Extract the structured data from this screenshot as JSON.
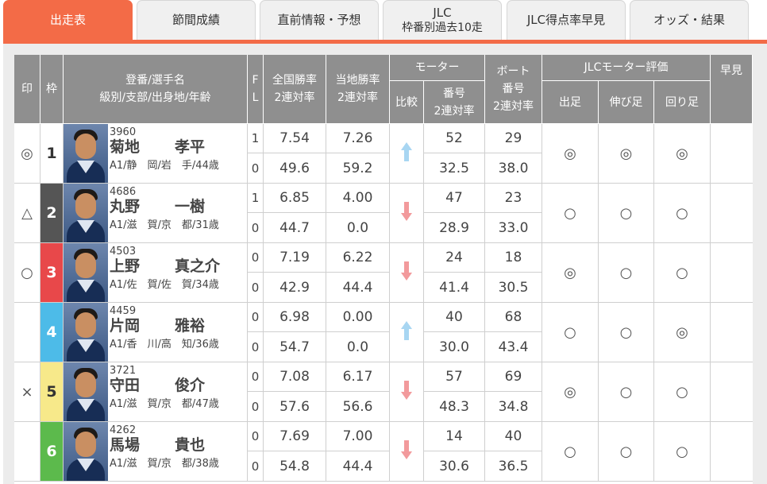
{
  "tabs": [
    {
      "label": "出走表",
      "sub": ""
    },
    {
      "label": "節間成績",
      "sub": ""
    },
    {
      "label": "直前情報・予想",
      "sub": ""
    },
    {
      "label": "JLC",
      "sub": "枠番別過去10走"
    },
    {
      "label": "JLC得点率早見",
      "sub": ""
    },
    {
      "label": "オッズ・結果",
      "sub": ""
    }
  ],
  "headers": {
    "mark": "印",
    "waku": "枠",
    "racer_line1": "登番/選手名",
    "racer_line2": "級別/支部/出身地/年齢",
    "fl_f": "F",
    "fl_l": "L",
    "national_line1": "全国勝率",
    "national_line2": "2連対率",
    "local_line1": "当地勝率",
    "local_line2": "2連対率",
    "motor": "モーター",
    "motor_compare": "比較",
    "motor_no_line1": "番号",
    "motor_no_line2": "2連対率",
    "boat_line1": "ボート",
    "boat_line2": "番号",
    "boat_line3": "2連対率",
    "jlc_eval": "JLCモーター評価",
    "jlc_start": "出足",
    "jlc_nobi": "伸び足",
    "jlc_mawari": "回り足",
    "hayami": "早見"
  },
  "colors": {
    "tab_active": "#f36b47",
    "header_bg": "#8f8f8f",
    "waku_1": "#ffffff",
    "waku_2": "#555555",
    "waku_3": "#e8484a",
    "waku_4": "#4dbbe8",
    "waku_5": "#f7e98a",
    "waku_6": "#5cba4c",
    "arrow_up": "#a8d6f2",
    "arrow_down": "#f29a9c"
  },
  "rows": [
    {
      "mark": "◎",
      "waku": "1",
      "waku_color": "waku_1",
      "waku_text_color": "#333333",
      "id": "3960",
      "last": "菊地",
      "first": "孝平",
      "info": "A1/静　岡/岩　手/44歳",
      "f": "1",
      "l": "0",
      "nat_win": "7.54",
      "nat_rate": "49.6",
      "loc_win": "7.26",
      "loc_rate": "59.2",
      "motor_compare": "up-arrow-icon",
      "motor_no": "52",
      "motor_rate": "32.5",
      "boat_no": "29",
      "boat_rate": "38.0",
      "eval_start": "◎",
      "eval_nobi": "◎",
      "eval_mawari": "◎",
      "hayami": ""
    },
    {
      "mark": "△",
      "waku": "2",
      "waku_color": "waku_2",
      "waku_text_color": "#ffffff",
      "id": "4686",
      "last": "丸野",
      "first": "一樹",
      "info": "A1/滋　賀/京　都/31歳",
      "f": "1",
      "l": "0",
      "nat_win": "6.85",
      "nat_rate": "44.7",
      "loc_win": "4.00",
      "loc_rate": "0.0",
      "motor_compare": "down-arrow-icon",
      "motor_no": "47",
      "motor_rate": "28.9",
      "boat_no": "23",
      "boat_rate": "33.0",
      "eval_start": "○",
      "eval_nobi": "○",
      "eval_mawari": "○",
      "hayami": ""
    },
    {
      "mark": "○",
      "waku": "3",
      "waku_color": "waku_3",
      "waku_text_color": "#ffffff",
      "id": "4503",
      "last": "上野",
      "first": "真之介",
      "info": "A1/佐　賀/佐　賀/34歳",
      "f": "0",
      "l": "0",
      "nat_win": "7.19",
      "nat_rate": "42.9",
      "loc_win": "6.22",
      "loc_rate": "44.4",
      "motor_compare": "down-arrow-icon",
      "motor_no": "24",
      "motor_rate": "41.4",
      "boat_no": "18",
      "boat_rate": "30.5",
      "eval_start": "◎",
      "eval_nobi": "○",
      "eval_mawari": "○",
      "hayami": ""
    },
    {
      "mark": "",
      "waku": "4",
      "waku_color": "waku_4",
      "waku_text_color": "#ffffff",
      "id": "4459",
      "last": "片岡",
      "first": "雅裕",
      "info": "A1/香　川/高　知/36歳",
      "f": "0",
      "l": "0",
      "nat_win": "6.98",
      "nat_rate": "54.7",
      "loc_win": "0.00",
      "loc_rate": "0.0",
      "motor_compare": "up-arrow-icon",
      "motor_no": "40",
      "motor_rate": "30.0",
      "boat_no": "68",
      "boat_rate": "43.4",
      "eval_start": "○",
      "eval_nobi": "○",
      "eval_mawari": "◎",
      "hayami": ""
    },
    {
      "mark": "×",
      "waku": "5",
      "waku_color": "waku_5",
      "waku_text_color": "#333333",
      "id": "3721",
      "last": "守田",
      "first": "俊介",
      "info": "A1/滋　賀/京　都/47歳",
      "f": "0",
      "l": "0",
      "nat_win": "7.08",
      "nat_rate": "57.6",
      "loc_win": "6.17",
      "loc_rate": "56.6",
      "motor_compare": "down-arrow-icon",
      "motor_no": "57",
      "motor_rate": "48.3",
      "boat_no": "69",
      "boat_rate": "34.8",
      "eval_start": "◎",
      "eval_nobi": "○",
      "eval_mawari": "○",
      "hayami": ""
    },
    {
      "mark": "",
      "waku": "6",
      "waku_color": "waku_6",
      "waku_text_color": "#ffffff",
      "id": "4262",
      "last": "馬場",
      "first": "貴也",
      "info": "A1/滋　賀/京　都/38歳",
      "f": "0",
      "l": "0",
      "nat_win": "7.69",
      "nat_rate": "54.8",
      "loc_win": "7.00",
      "loc_rate": "44.4",
      "motor_compare": "down-arrow-icon",
      "motor_no": "14",
      "motor_rate": "30.6",
      "boat_no": "40",
      "boat_rate": "36.5",
      "eval_start": "○",
      "eval_nobi": "○",
      "eval_mawari": "○",
      "hayami": ""
    }
  ]
}
